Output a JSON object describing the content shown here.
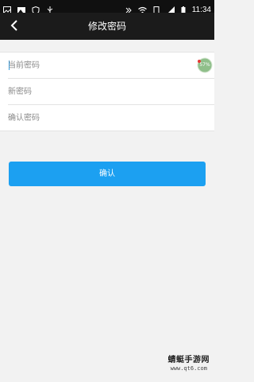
{
  "status_bar": {
    "time": "11:34",
    "left_icons": [
      "image-icon",
      "photo-icon",
      "shield-icon",
      "usb-icon"
    ],
    "right_icons": [
      "nfc-icon",
      "wifi-icon",
      "sim-icon",
      "signal-icon",
      "battery-icon"
    ]
  },
  "header": {
    "title": "修改密码",
    "back_icon": "chevron-left-icon"
  },
  "form": {
    "current_password": {
      "placeholder": "当前密码",
      "value": ""
    },
    "new_password": {
      "placeholder": "新密码",
      "value": ""
    },
    "confirm_password": {
      "placeholder": "确认密码",
      "value": ""
    }
  },
  "overlay_badge": {
    "text": "57%",
    "value": 57
  },
  "confirm_button": {
    "label": "确认"
  },
  "watermark": {
    "title": "蜻蜓手游网",
    "url": "www.qt6.com"
  },
  "colors": {
    "status_bar_bg": "#101010",
    "app_bar_bg": "#1b1b1b",
    "page_bg": "#f2f2f2",
    "accent": "#1ca0f1",
    "badge_green": "#8fbf8a"
  }
}
